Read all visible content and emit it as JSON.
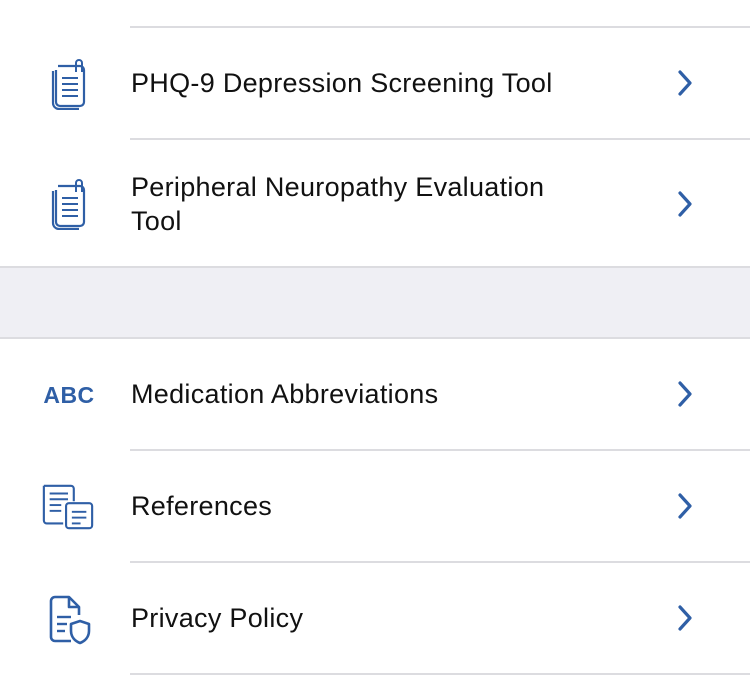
{
  "section1": {
    "items": [
      {
        "label": "PHQ-9 Depression Screening Tool",
        "icon": "clipboard-document-icon"
      },
      {
        "label": "Peripheral Neuropathy Evaluation Tool",
        "icon": "clipboard-document-icon"
      }
    ]
  },
  "section2": {
    "items": [
      {
        "label": "Medication Abbreviations",
        "icon": "abc-text-icon",
        "icon_text": "ABC"
      },
      {
        "label": "References",
        "icon": "documents-list-icon"
      },
      {
        "label": "Privacy Policy",
        "icon": "document-shield-icon"
      }
    ]
  },
  "colors": {
    "accent": "#2f5fa6",
    "separator": "#dcdce0",
    "group_background": "#efeff4",
    "text": "#111111"
  }
}
